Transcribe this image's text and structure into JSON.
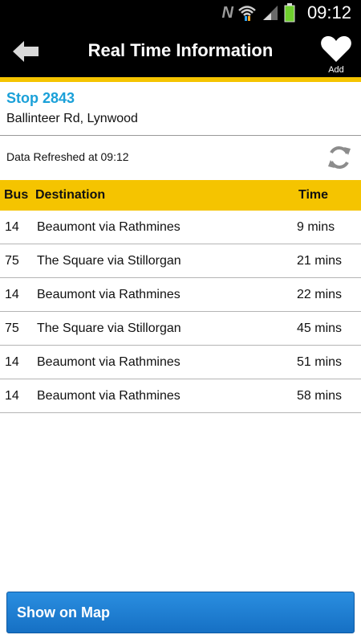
{
  "status_bar": {
    "notification_letter": "N",
    "time": "09:12"
  },
  "header": {
    "title": "Real Time Information",
    "add_label": "Add"
  },
  "stop": {
    "number": "Stop 2843",
    "address": "Ballinteer Rd, Lynwood"
  },
  "refresh": {
    "text": "Data Refreshed at 09:12"
  },
  "table": {
    "headers": {
      "bus": "Bus",
      "destination": "Destination",
      "time": "Time"
    },
    "rows": [
      {
        "bus": "14",
        "destination": "Beaumont via Rathmines",
        "time": "9 mins"
      },
      {
        "bus": "75",
        "destination": "The Square via Stillorgan",
        "time": "21 mins"
      },
      {
        "bus": "14",
        "destination": "Beaumont via Rathmines",
        "time": "22 mins"
      },
      {
        "bus": "75",
        "destination": "The Square via Stillorgan",
        "time": "45 mins"
      },
      {
        "bus": "14",
        "destination": "Beaumont via Rathmines",
        "time": "51 mins"
      },
      {
        "bus": "14",
        "destination": "Beaumont via Rathmines",
        "time": "58 mins"
      }
    ]
  },
  "map_button": {
    "label": "Show on Map"
  },
  "colors": {
    "accent_yellow": "#f5c400",
    "stop_blue": "#1aa0d8",
    "button_blue": "#1f7fd4"
  }
}
